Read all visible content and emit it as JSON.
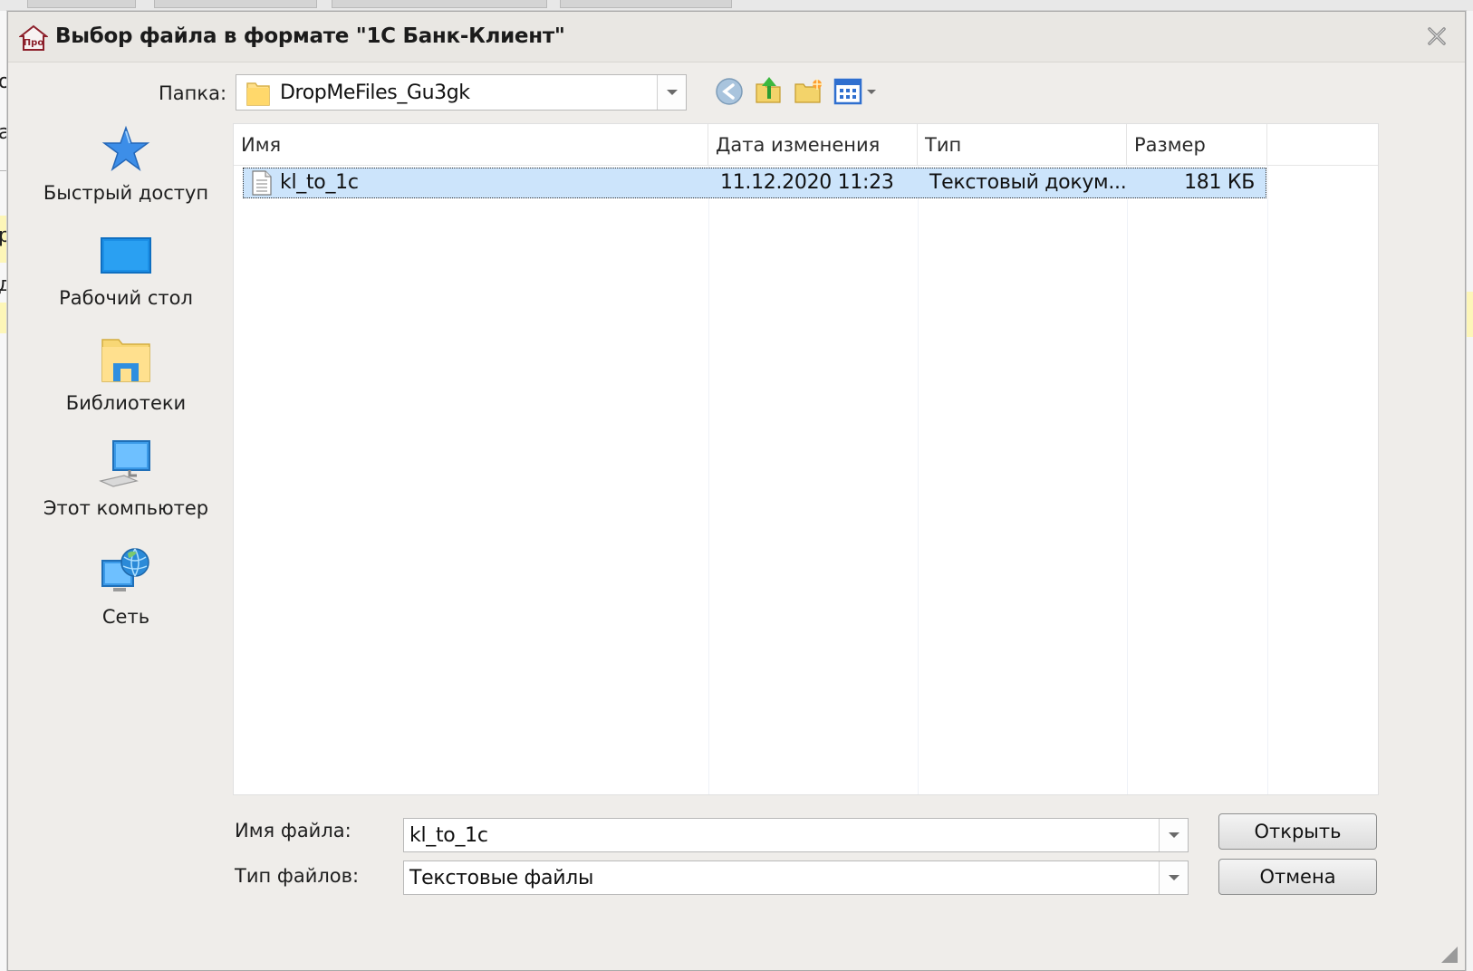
{
  "dialog": {
    "title": "Выбор файла в формате \"1С Банк-Клиент\"",
    "logo_text": "Про"
  },
  "folder": {
    "label": "Папка:",
    "current": "DropMeFiles_Gu3gk"
  },
  "toolbar": {
    "icons": [
      "back-icon",
      "up-folder-icon",
      "new-folder-icon",
      "view-menu-icon"
    ]
  },
  "places": [
    {
      "label": "Быстрый доступ",
      "icon": "star-icon"
    },
    {
      "label": "Рабочий стол",
      "icon": "desktop-icon"
    },
    {
      "label": "Библиотеки",
      "icon": "libraries-icon"
    },
    {
      "label": "Этот компьютер",
      "icon": "computer-icon"
    },
    {
      "label": "Сеть",
      "icon": "network-icon"
    }
  ],
  "file_list": {
    "columns": [
      "Имя",
      "Дата изменения",
      "Тип",
      "Размер"
    ],
    "rows": [
      {
        "name": "kl_to_1c",
        "modified": "11.12.2020 11:23",
        "type": "Текстовый докум...",
        "size": "181 КБ",
        "selected": true
      }
    ]
  },
  "filename": {
    "label": "Имя файла:",
    "value": "kl_to_1c"
  },
  "filetype": {
    "label": "Тип файлов:",
    "value": "Текстовые файлы"
  },
  "buttons": {
    "open": "Открыть",
    "cancel": "Отмена"
  },
  "colors": {
    "selection": "#cce4fb",
    "dialog_bg": "#efedea",
    "background_highlight": "#fdf6b8"
  },
  "background_fragments": [
    "о",
    "а",
    "р",
    "д"
  ]
}
